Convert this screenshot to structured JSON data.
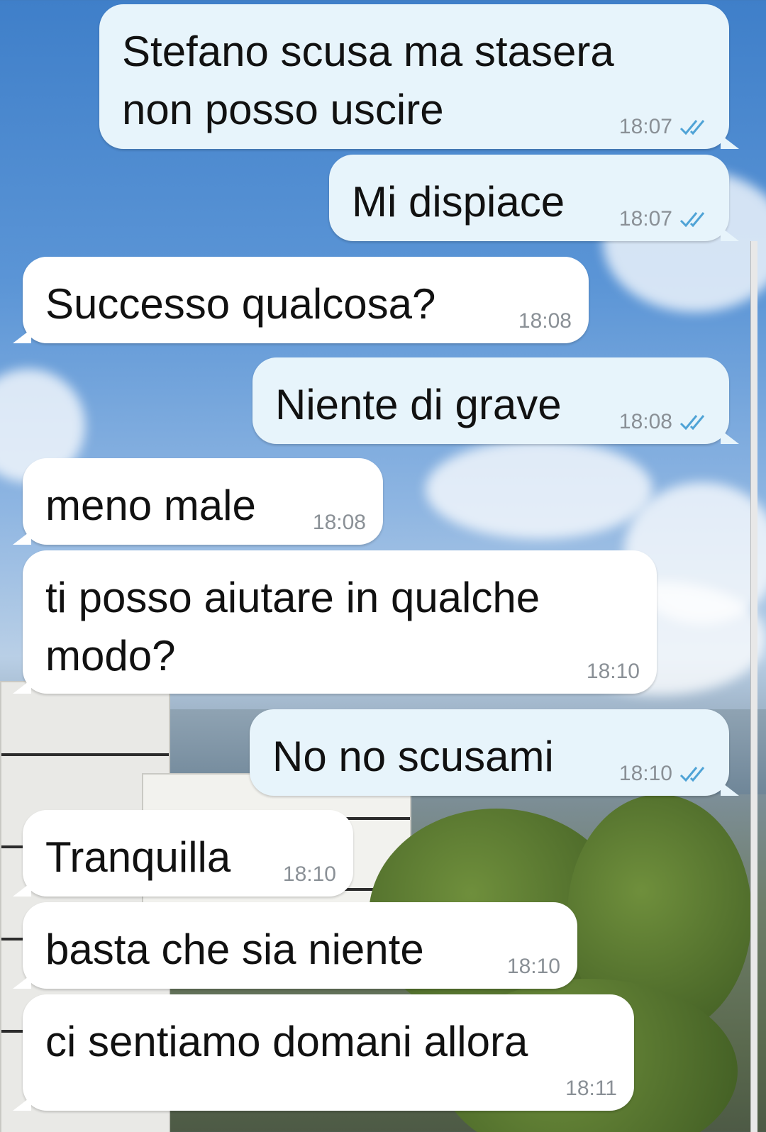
{
  "colors": {
    "outgoing_bubble": "#e7f4fb",
    "incoming_bubble": "#ffffff",
    "time_text": "#8a9096",
    "read_ticks": "#4fa3d6"
  },
  "messages": [
    {
      "direction": "out",
      "text": "Stefano scusa ma stasera\nnon posso uscire",
      "time": "18:07",
      "status_icon": "double-check-read-icon"
    },
    {
      "direction": "out",
      "text": "Mi dispiace",
      "time": "18:07",
      "status_icon": "double-check-read-icon"
    },
    {
      "direction": "in",
      "text": "Successo qualcosa?",
      "time": "18:08"
    },
    {
      "direction": "out",
      "text": "Niente di grave",
      "time": "18:08",
      "status_icon": "double-check-read-icon"
    },
    {
      "direction": "in",
      "text": "meno male",
      "time": "18:08"
    },
    {
      "direction": "in",
      "text": "ti posso aiutare in qualche\nmodo?",
      "time": "18:10"
    },
    {
      "direction": "out",
      "text": "No no scusami",
      "time": "18:10",
      "status_icon": "double-check-read-icon"
    },
    {
      "direction": "in",
      "text": "Tranquilla",
      "time": "18:10"
    },
    {
      "direction": "in",
      "text": "basta che sia niente",
      "time": "18:10"
    },
    {
      "direction": "in",
      "text": "ci sentiamo domani allora",
      "time": "18:11"
    }
  ]
}
